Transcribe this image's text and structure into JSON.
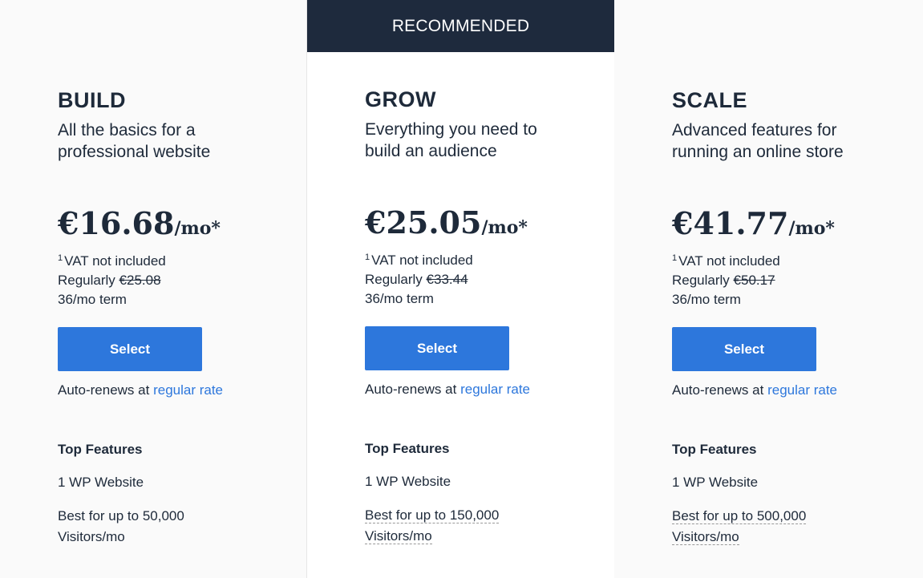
{
  "banner": "RECOMMENDED",
  "plans": [
    {
      "name": "BUILD",
      "desc": "All the basics for a professional website",
      "price": "€16.68",
      "per": "/mo*",
      "vat_sup": "1",
      "vat": "VAT not included",
      "regularly": "Regularly",
      "old_price": "€25.08",
      "term": "36/mo term",
      "button": "Select",
      "renew_prefix": "Auto-renews at",
      "renew_link": "regular rate",
      "features_title": "Top Features",
      "f1": "1 WP Website",
      "f2a": "Best for up to 50,000",
      "f2b": "Visitors/mo"
    },
    {
      "name": "GROW",
      "desc": "Everything you need to build an audience",
      "price": "€25.05",
      "per": "/mo*",
      "vat_sup": "1",
      "vat": "VAT not included",
      "regularly": "Regularly",
      "old_price": "€33.44",
      "term": "36/mo term",
      "button": "Select",
      "renew_prefix": "Auto-renews at",
      "renew_link": "regular rate",
      "features_title": "Top Features",
      "f1": "1 WP Website",
      "f2a": "Best for up to 150,000",
      "f2b": "Visitors/mo"
    },
    {
      "name": "SCALE",
      "desc": "Advanced features for running an online store",
      "price": "€41.77",
      "per": "/mo*",
      "vat_sup": "1",
      "vat": "VAT not included",
      "regularly": "Regularly",
      "old_price": "€50.17",
      "term": "36/mo term",
      "button": "Select",
      "renew_prefix": "Auto-renews at",
      "renew_link": "regular rate",
      "features_title": "Top Features",
      "f1": "1 WP Website",
      "f2a": "Best for up to 500,000",
      "f2b": "Visitors/mo"
    }
  ],
  "colors": {
    "accent": "#2d77dc",
    "banner": "#1e2a3d",
    "text": "#1e2a3a"
  }
}
